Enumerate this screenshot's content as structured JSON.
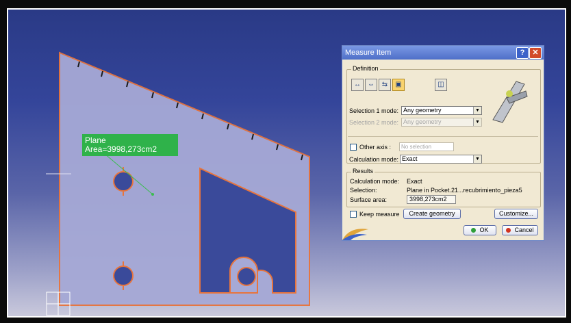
{
  "viewport": {
    "annotation": {
      "line1": "Plane",
      "line2": "Area=3998,273cm2"
    }
  },
  "dialog": {
    "title": "Measure Item",
    "help_label": "?",
    "close_label": "✕",
    "definition": {
      "group_label": "Definition",
      "tool_icons": [
        "measure-item-icon",
        "measure-between-icon",
        "measure-thickness-icon",
        "measure-inertia-icon",
        "keep-measure-icon"
      ],
      "selection1_label": "Selection 1 mode:",
      "selection1_value": "Any geometry",
      "selection2_label": "Selection 2 mode:",
      "selection2_value": "Any geometry",
      "other_axis_label": "Other axis :",
      "other_axis_value": "No selection",
      "calc_mode_label": "Calculation mode:",
      "calc_mode_value": "Exact"
    },
    "results": {
      "group_label": "Results",
      "rows": [
        {
          "label": "Calculation mode:",
          "value": "Exact"
        },
        {
          "label": "Selection:",
          "value": "Plane in Pocket.21...recubrimiento_pieza5"
        },
        {
          "label": "Surface area:",
          "value": "3998,273cm2"
        }
      ]
    },
    "keep_measure_label": "Keep measure",
    "create_geometry_label": "Create geometry",
    "customize_label": "Customize...",
    "ok_label": "OK",
    "cancel_label": "Cancel",
    "colors": {
      "ok_dot": "#2f9e3a",
      "cancel_dot": "#d2331f"
    }
  }
}
